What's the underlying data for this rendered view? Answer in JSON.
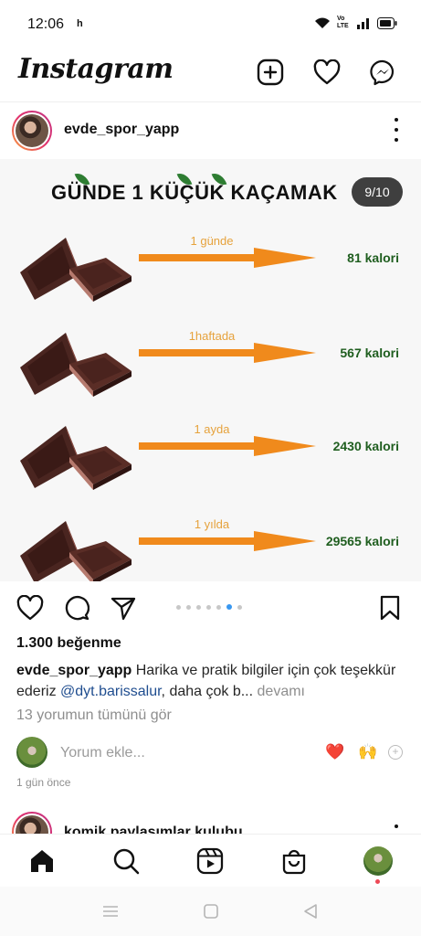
{
  "status_bar": {
    "time": "12:06",
    "extra": "h",
    "network_label": "Vo LTE"
  },
  "header": {
    "logo": "Instagram"
  },
  "post": {
    "username": "evde_spor_yapp",
    "slide_counter": "9/10",
    "slide": {
      "title": "GÜNDE 1 KÜÇÜK KAÇAMAK",
      "rows": [
        {
          "period": "1 günde",
          "calories": "81 kalori"
        },
        {
          "period": "1haftada",
          "calories": "567 kalori"
        },
        {
          "period": "1 ayda",
          "calories": "2430 kalori"
        },
        {
          "period": "1 yılda",
          "calories": "29565 kalori"
        }
      ]
    },
    "carousel": {
      "count": 10,
      "current": 9
    },
    "likes": "1.300 beğenme",
    "caption": {
      "username": "evde_spor_yapp",
      "text_part1": "Harika ve pratik bilgiler için çok teşekkür ederiz",
      "mention": "@dyt.barissalur",
      "text_part2": ", daha çok b...",
      "more": "devamı"
    },
    "view_comments": "13 yorumun tümünü gör",
    "comment_placeholder": "Yorum ekle...",
    "quick_emojis": [
      "❤️",
      "🙌"
    ],
    "time_ago": "1 gün önce"
  },
  "next_post": {
    "username": "komik paylaşımlar kulubu"
  },
  "colors": {
    "accent_orange": "#f08a1c",
    "kcal_green": "#1f5e1f",
    "active_dot": "#3897f0",
    "notif": "#ed4956"
  }
}
